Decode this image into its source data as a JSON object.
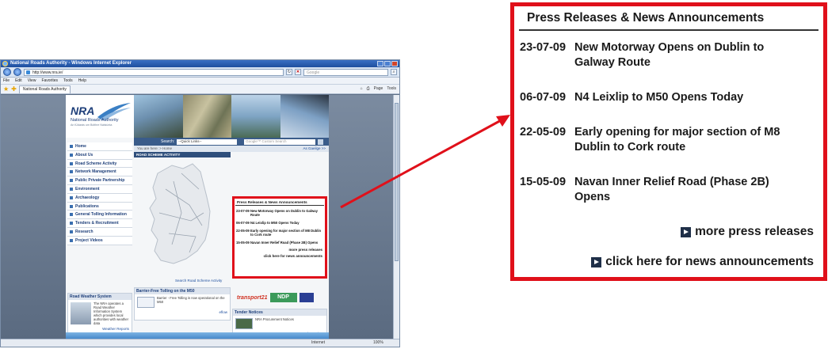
{
  "browser": {
    "title": "National Roads Authority - Windows Internet Explorer",
    "url": "http://www.nra.ie/",
    "search_placeholder": "Google",
    "menu": [
      "File",
      "Edit",
      "View",
      "Favorites",
      "Tools",
      "Help"
    ],
    "tab_label": "National Roads Authority",
    "commands": [
      "Page",
      "Tools"
    ],
    "status_zone": "Internet",
    "status_zoom": "100%"
  },
  "site": {
    "logo": "NRA",
    "logo_sub": "National Roads Authority",
    "logo_tagline": "An tÚdarás um Bóithre Náisiúnta",
    "search_label": "Search:",
    "quick_links": "--Quick Links--",
    "google_search": "Google™ Custom Search",
    "breadcrumb": "You are here: > Home",
    "gaeilge": "As Gaeilge >>",
    "scheme_header": "ROAD SCHEME ACTIVITY",
    "map_link": "Search Road Scheme Activity",
    "nav": [
      "Home",
      "About Us",
      "Road Scheme Activity",
      "Network Management",
      "Public Private Partnership",
      "Environment",
      "Archaeology",
      "Publications",
      "General Tolling Information",
      "Tenders & Recruitment",
      "Research",
      "Project Videos"
    ],
    "road_weather": {
      "header": "Road Weather System",
      "body": "The NRA operates a Road Weather Information System which provides local authorities with weather data",
      "link": "Weather Reports"
    },
    "barrier": {
      "header": "Barrier-Free Tolling on the M50",
      "body": "Barrier - Free Tolling is now operational on the M50",
      "link": "eflow",
      "img_label": "eflow"
    },
    "tender": {
      "header": "Tender Notices",
      "body": "NRA Procurement Notices",
      "link": "Tender Notices"
    },
    "logos": {
      "transport21": "transport21",
      "ndp": "NDP"
    }
  },
  "press": {
    "title": "Press Releases & News Announcements",
    "items": [
      {
        "date": "23-07-09",
        "text": "New Motorway Opens on Dublin to Galway Route"
      },
      {
        "date": "06-07-09",
        "text": "N4 Leixlip to M50 Opens Today"
      },
      {
        "date": "22-05-09",
        "text": "Early opening for major section of M8 Dublin to Cork route"
      },
      {
        "date": "15-05-09",
        "text": "Navan Inner Relief Road (Phase 2B) Opens"
      }
    ],
    "more_link": "more press releases",
    "news_link": "click here for news announcements"
  },
  "colors": {
    "highlight": "#e0101a",
    "nra_blue": "#1e3f7a"
  }
}
